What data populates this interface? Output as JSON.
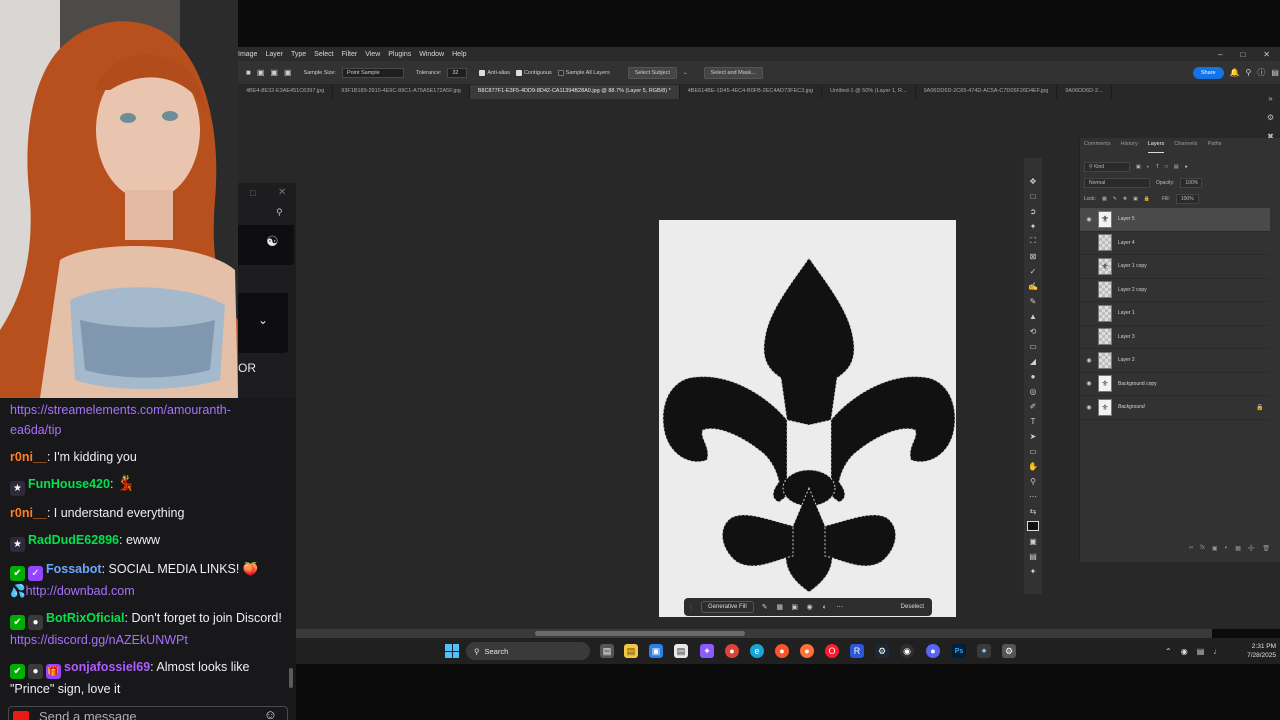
{
  "photoshop": {
    "menu": [
      "Image",
      "Layer",
      "Type",
      "Select",
      "Filter",
      "View",
      "Plugins",
      "Window",
      "Help"
    ],
    "options": {
      "sample_size_label": "Sample Size:",
      "sample_size_value": "Point Sample",
      "tolerance_label": "Tolerance:",
      "tolerance_value": "32",
      "anti_alias": "Anti-alias",
      "contiguous": "Contiguous",
      "sample_all_layers": "Sample All Layers",
      "select_subject": "Select Subject",
      "select_and_mask": "Select and Mask...",
      "share": "Share"
    },
    "tabs": [
      "4BE4-8E32-E3AE451C6397.jpg",
      "93F1B189-2910-4E9C-89C1-A75A5E172A5F.jpg",
      "B8C877F1-E3F5-4DD9-8D42-CA11394B28A0.jpg @ 88.7% (Layer 5, RGB/8) *",
      "4BE614BE-1D45-4EC4-B0FB-2EC4AD73FEC3.jpg",
      "Untitled-1 @ 50% (Layer 1, R...",
      "9A06DD6D-2C65-474D-AC5A-C7D05F26D4EF.jpg",
      "9A06DD6D-2..."
    ],
    "context_bar": {
      "generative_fill": "Generative Fill",
      "deselect": "Deselect"
    }
  },
  "layers_panel": {
    "tabs": [
      "Comments",
      "History",
      "Layers",
      "Channels",
      "Paths"
    ],
    "kind": "Kind",
    "blend_mode": "Normal",
    "opacity_label": "Opacity:",
    "opacity_value": "100%",
    "lock_label": "Lock:",
    "fill_label": "Fill:",
    "fill_value": "100%",
    "layers": [
      {
        "name": "Layer 5",
        "visible": true,
        "selected": true
      },
      {
        "name": "Layer 4",
        "visible": false
      },
      {
        "name": "Layer 1 copy",
        "visible": false
      },
      {
        "name": "Layer 2 copy",
        "visible": false
      },
      {
        "name": "Layer 1",
        "visible": false
      },
      {
        "name": "Layer 3",
        "visible": false
      },
      {
        "name": "Layer 2",
        "visible": true
      },
      {
        "name": "Background copy",
        "visible": true
      },
      {
        "name": "Background",
        "visible": true,
        "locked": true
      }
    ]
  },
  "taskbar": {
    "search_label": "Search",
    "time": "2:31 PM",
    "date": "7/28/2025"
  },
  "side_panel": {
    "fragment_text": "OR"
  },
  "chat": {
    "messages": [
      {
        "text_link_1": "https://streamelements.com/amouranth-",
        "text_link_2": "ea6da/tip"
      },
      {
        "user": "r0ni__",
        "user_color": "#ff7f24",
        "text": ": I'm kidding you"
      },
      {
        "user": "FunHouse420",
        "user_color": "#00e34c",
        "text": ": "
      },
      {
        "user": "r0ni__",
        "user_color": "#ff7f24",
        "text": ": I understand everything"
      },
      {
        "user": "RadDudE62896",
        "user_color": "#00e34c",
        "text": ": ewww"
      },
      {
        "user": "Fossabot",
        "user_color": "#6aa8ff",
        "text": ": SOCIAL MEDIA LINKS! ",
        "link": "http://downbad.com"
      },
      {
        "user": "BotRixOficial",
        "user_color": "#00e34c",
        "text": ": Don't forget to join Discord! ",
        "link": "https://discord.gg/nAZEkUNWPt"
      },
      {
        "user": "sonjafossiel69",
        "user_color": "#b05cff",
        "text": ": Almost looks like \"Prince\" sign, love it"
      }
    ],
    "input_placeholder": "Send a message"
  }
}
